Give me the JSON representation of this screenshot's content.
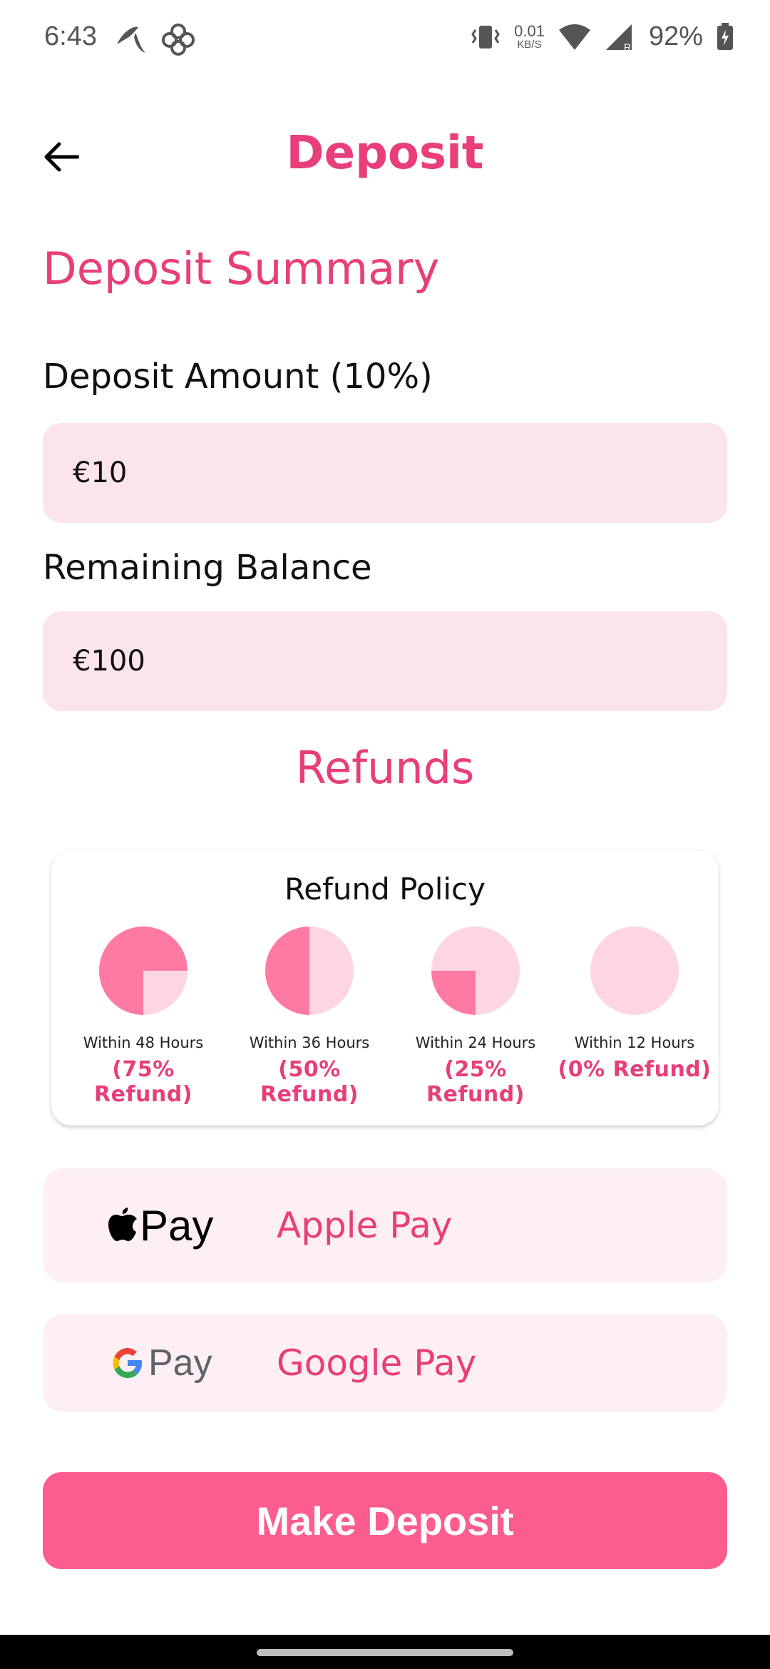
{
  "status_bar": {
    "time": "6:43",
    "net_speed_value": "0.01",
    "net_speed_unit": "KB/S",
    "battery": "92%"
  },
  "header": {
    "title": "Deposit"
  },
  "summary": {
    "title": "Deposit Summary",
    "deposit_label": "Deposit Amount (10%)",
    "deposit_value": "€10",
    "balance_label": "Remaining Balance",
    "balance_value": "€100"
  },
  "refunds": {
    "title": "Refunds",
    "card_title": "Refund Policy",
    "items": [
      {
        "label": "Within 48 Hours",
        "percent": "(75% Refund)",
        "fraction": 0.75
      },
      {
        "label": "Within 36 Hours",
        "percent": "(50% Refund)",
        "fraction": 0.5
      },
      {
        "label": "Within 24 Hours",
        "percent": "(25% Refund)",
        "fraction": 0.25
      },
      {
        "label": "Within 12 Hours",
        "percent": "(0% Refund)",
        "fraction": 0.0
      }
    ]
  },
  "payment": {
    "apple_logo_text": "Pay",
    "apple_label": "Apple Pay",
    "google_logo_text": "Pay",
    "google_label": "Google Pay"
  },
  "action": {
    "make_deposit_label": "Make Deposit"
  },
  "colors": {
    "accent": "#e83e7a",
    "button": "#fd5c8e",
    "field_bg": "#fce4ec",
    "pie_filled": "#ff7aa2",
    "pie_empty": "#fdd6e2"
  }
}
